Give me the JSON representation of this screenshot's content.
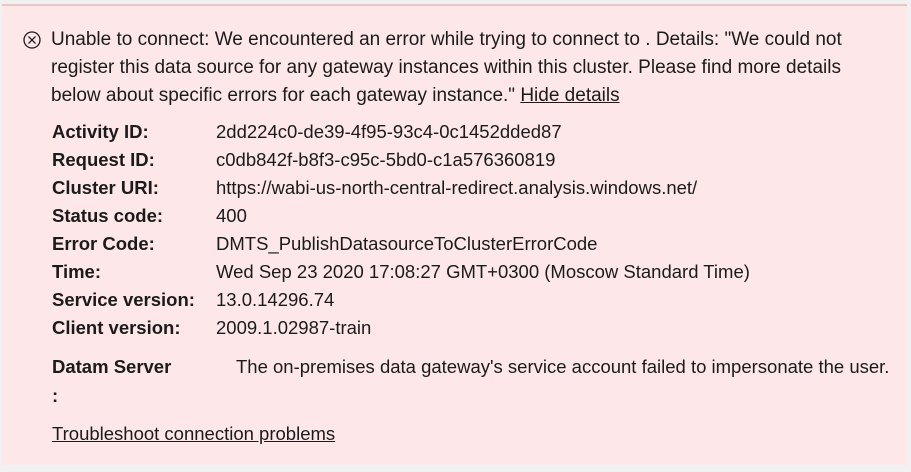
{
  "error": {
    "icon": "error-circle-x-icon",
    "message": "Unable to connect: We encountered an error while trying to connect to . Details: \"We could not register this data source for any gateway instances within this cluster. Please find more details below about specific errors for each gateway instance.\"",
    "hide_details_label": "Hide details"
  },
  "details": [
    {
      "label": "Activity ID:",
      "value": "2dd224c0-de39-4f95-93c4-0c1452dded87"
    },
    {
      "label": "Request ID:",
      "value": "c0db842f-b8f3-c95c-5bd0-c1a576360819"
    },
    {
      "label": "Cluster URI:",
      "value": "https://wabi-us-north-central-redirect.analysis.windows.net/"
    },
    {
      "label": "Status code:",
      "value": "400"
    },
    {
      "label": "Error Code:",
      "value": "DMTS_PublishDatasourceToClusterErrorCode"
    },
    {
      "label": "Time:",
      "value": "Wed Sep 23 2020 17:08:27 GMT+0300 (Moscow Standard Time)"
    },
    {
      "label": "Service version:",
      "value": "13.0.14296.74"
    },
    {
      "label": "Client version:",
      "value": "2009.1.02987-train"
    }
  ],
  "server": {
    "label": "Datam Server :",
    "value": "The on-premises data gateway's service account failed to impersonate the user."
  },
  "troubleshoot_label": "Troubleshoot connection problems",
  "colors": {
    "background": "#fde7e9",
    "text": "#1b1b1b"
  }
}
